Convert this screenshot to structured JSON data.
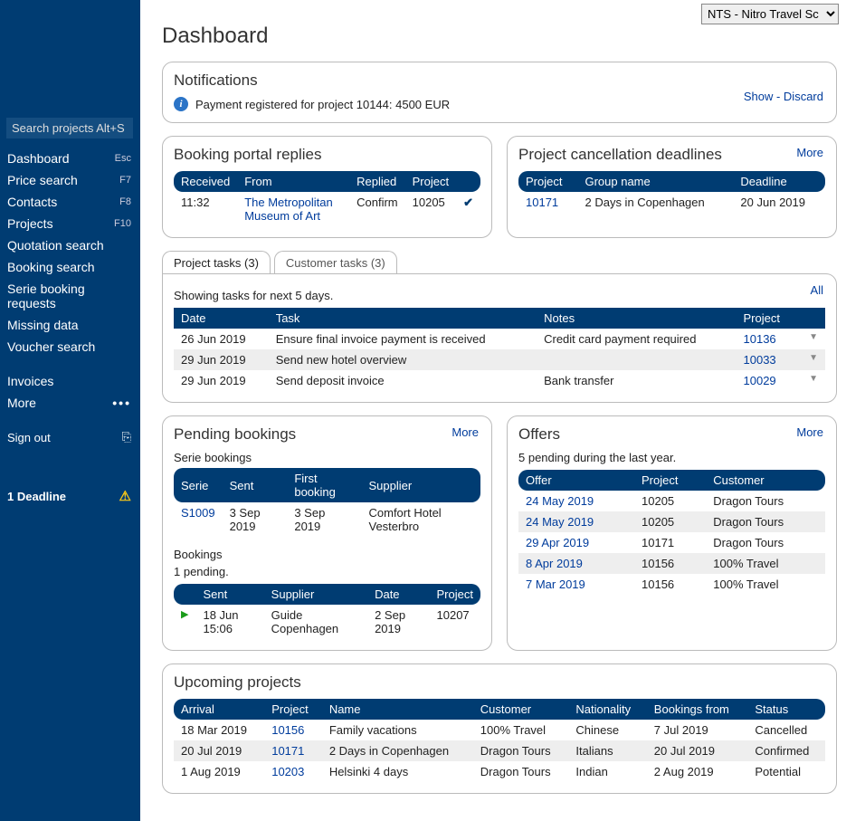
{
  "top_select": {
    "selected": "NTS - Nitro Travel Sc"
  },
  "search_placeholder": "Search projects Alt+S",
  "nav": [
    {
      "label": "Dashboard",
      "key": "Esc"
    },
    {
      "label": "Price search",
      "key": "F7"
    },
    {
      "label": "Contacts",
      "key": "F8"
    },
    {
      "label": "Projects",
      "key": "F10"
    },
    {
      "label": "Quotation search",
      "key": ""
    },
    {
      "label": "Booking search",
      "key": ""
    },
    {
      "label": "Serie booking requests",
      "key": ""
    },
    {
      "label": "Missing data",
      "key": ""
    },
    {
      "label": "Voucher search",
      "key": ""
    }
  ],
  "nav2": [
    {
      "label": "Invoices",
      "key": ""
    },
    {
      "label": "More",
      "key": "dots"
    }
  ],
  "signout": "Sign out",
  "deadline": "1 Deadline",
  "page_title": "Dashboard",
  "notifications": {
    "title": "Notifications",
    "text": "Payment registered for project 10144: 4500 EUR",
    "show": "Show",
    "dash": " - ",
    "discard": "Discard"
  },
  "booking_replies": {
    "title": "Booking portal replies",
    "cols": [
      "Received",
      "From",
      "Replied",
      "Project",
      ""
    ],
    "rows": [
      {
        "received": "11:32",
        "from": "The Metropolitan Museum of Art",
        "replied": "Confirm",
        "project": "10205",
        "check": "✔"
      }
    ]
  },
  "cancel_deadlines": {
    "title": "Project cancellation deadlines",
    "more": "More",
    "cols": [
      "Project",
      "Group name",
      "Deadline"
    ],
    "rows": [
      {
        "project": "10171",
        "group": "2 Days in Copenhagen",
        "deadline": "20 Jun 2019"
      }
    ]
  },
  "tasks": {
    "tab1": "Project tasks (3)",
    "tab2": "Customer tasks (3)",
    "showing": "Showing tasks for next 5 days.",
    "all": "All",
    "cols": [
      "Date",
      "Task",
      "Notes",
      "Project",
      ""
    ],
    "rows": [
      {
        "date": "26 Jun 2019",
        "task": "Ensure final invoice payment is received",
        "notes": "Credit card payment required",
        "project": "10136"
      },
      {
        "date": "29 Jun 2019",
        "task": "Send new hotel overview",
        "notes": "",
        "project": "10033"
      },
      {
        "date": "29 Jun 2019",
        "task": "Send deposit invoice",
        "notes": "Bank transfer",
        "project": "10029"
      }
    ]
  },
  "pending": {
    "title": "Pending bookings",
    "more": "More",
    "serie_label": "Serie bookings",
    "serie_cols": [
      "Serie",
      "Sent",
      "First booking",
      "Supplier"
    ],
    "serie_rows": [
      {
        "serie": "S1009",
        "sent": "3 Sep 2019",
        "first": "3 Sep 2019",
        "supplier": "Comfort Hotel Vesterbro"
      }
    ],
    "bookings_label": "Bookings",
    "pending_text": "1 pending.",
    "book_cols": [
      "",
      "Sent",
      "Supplier",
      "Date",
      "Project"
    ],
    "book_rows": [
      {
        "sent": "18 Jun 15:06",
        "supplier": "Guide Copenhagen",
        "date": "2 Sep 2019",
        "project": "10207"
      }
    ]
  },
  "offers": {
    "title": "Offers",
    "more": "More",
    "sub": "5 pending during the last year.",
    "cols": [
      "Offer",
      "Project",
      "Customer"
    ],
    "rows": [
      {
        "offer": "24 May 2019",
        "project": "10205",
        "customer": "Dragon Tours"
      },
      {
        "offer": "24 May 2019",
        "project": "10205",
        "customer": "Dragon Tours"
      },
      {
        "offer": "29 Apr 2019",
        "project": "10171",
        "customer": "Dragon Tours"
      },
      {
        "offer": "8 Apr 2019",
        "project": "10156",
        "customer": "100% Travel"
      },
      {
        "offer": "7 Mar 2019",
        "project": "10156",
        "customer": "100% Travel"
      }
    ]
  },
  "upcoming": {
    "title": "Upcoming projects",
    "cols": [
      "Arrival",
      "Project",
      "Name",
      "Customer",
      "Nationality",
      "Bookings from",
      "Status"
    ],
    "rows": [
      {
        "arrival": "18 Mar 2019",
        "project": "10156",
        "name": "Family vacations",
        "customer": "100% Travel",
        "nat": "Chinese",
        "bf": "7 Jul 2019",
        "status": "Cancelled"
      },
      {
        "arrival": "20 Jul 2019",
        "project": "10171",
        "name": "2 Days in Copenhagen",
        "customer": "Dragon Tours",
        "nat": "Italians",
        "bf": "20 Jul 2019",
        "status": "Confirmed"
      },
      {
        "arrival": "1 Aug 2019",
        "project": "10203",
        "name": "Helsinki 4 days",
        "customer": "Dragon Tours",
        "nat": "Indian",
        "bf": "2 Aug 2019",
        "status": "Potential"
      }
    ]
  }
}
